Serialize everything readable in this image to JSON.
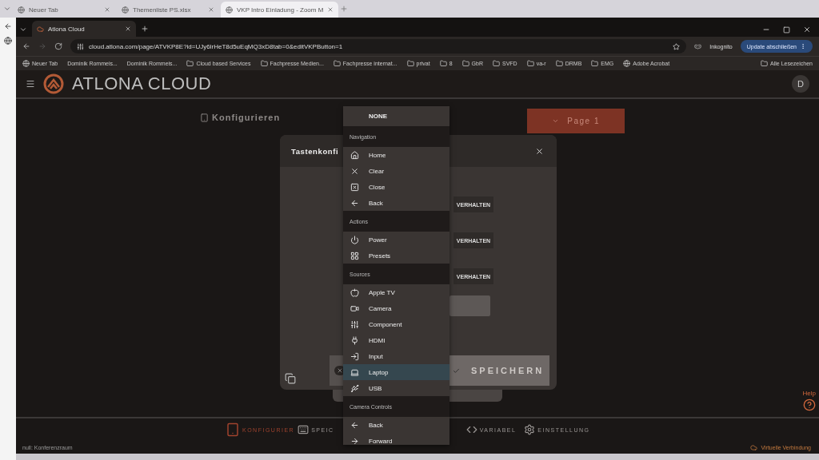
{
  "outer_tabs": [
    {
      "label": "Neuer Tab",
      "selected": false
    },
    {
      "label": "Themenliste PS.xlsx",
      "selected": false
    },
    {
      "label": "VKP Intro Einladung - Zoom M",
      "selected": true
    }
  ],
  "inner_tabs": [
    {
      "label": "Atlona Cloud",
      "selected": true
    }
  ],
  "address_bar": {
    "url": "cloud.atlona.com/page/ATVKP8E?id=UJy6lrHeT8d5uEqMQ3xD8tab=0&editVKPButton=1",
    "incognito": "Inkognito",
    "update_button": "Update abschließen"
  },
  "bookmarks": [
    {
      "label": "Neuer Tab",
      "kind": "site"
    },
    {
      "label": "Dominik Rommeis...",
      "kind": "plain"
    },
    {
      "label": "Dominik Rommeis...",
      "kind": "plain"
    },
    {
      "label": "Cloud based Services",
      "kind": "folder"
    },
    {
      "label": "Fachpresse Medien...",
      "kind": "folder"
    },
    {
      "label": "Fachpresse internat...",
      "kind": "folder"
    },
    {
      "label": "privat",
      "kind": "folder"
    },
    {
      "label": "8",
      "kind": "folder"
    },
    {
      "label": "GbR",
      "kind": "folder"
    },
    {
      "label": "SVFD",
      "kind": "folder"
    },
    {
      "label": "va-r",
      "kind": "folder"
    },
    {
      "label": "DRMB",
      "kind": "folder"
    },
    {
      "label": "EMG",
      "kind": "folder"
    },
    {
      "label": "Adobe Acrobat",
      "kind": "site"
    }
  ],
  "all_bookmarks": "Alle Lesezeichen",
  "app": {
    "logo": "ATLONA CLOUD",
    "avatar": "D",
    "section_title": "Konfigurieren",
    "page_button": "Page 1",
    "help": "Help"
  },
  "modal": {
    "title": "Tastenkonfi",
    "behavior_buttons": [
      "VERHALTEN",
      "VERHALTEN",
      "VERHALTEN"
    ],
    "save_button": "SPEICHERN"
  },
  "menu": {
    "items": [
      {
        "kind": "none",
        "label": "NONE",
        "selected": false
      },
      {
        "kind": "header",
        "label": "Navigation"
      },
      {
        "kind": "item",
        "label": "Home",
        "selected": false
      },
      {
        "kind": "item",
        "label": "Clear",
        "selected": false
      },
      {
        "kind": "item",
        "label": "Close",
        "selected": false
      },
      {
        "kind": "item",
        "label": "Back",
        "selected": false
      },
      {
        "kind": "header",
        "label": "Actions"
      },
      {
        "kind": "item",
        "label": "Power",
        "selected": false
      },
      {
        "kind": "item",
        "label": "Presets",
        "selected": false
      },
      {
        "kind": "header",
        "label": "Sources"
      },
      {
        "kind": "item",
        "label": "Apple TV",
        "selected": false
      },
      {
        "kind": "item",
        "label": "Camera",
        "selected": false
      },
      {
        "kind": "item",
        "label": "Component",
        "selected": false
      },
      {
        "kind": "item",
        "label": "HDMI",
        "selected": false
      },
      {
        "kind": "item",
        "label": "Input",
        "selected": false
      },
      {
        "kind": "item",
        "label": "Laptop",
        "selected": true
      },
      {
        "kind": "item",
        "label": "USB",
        "selected": false
      },
      {
        "kind": "header",
        "label": "Camera Controls"
      },
      {
        "kind": "item",
        "label": "Back",
        "selected": false
      },
      {
        "kind": "item",
        "label": "Forward",
        "selected": false
      }
    ]
  },
  "bottom_nav": [
    {
      "label": "KONFIGURIER",
      "selected": true
    },
    {
      "label": "SPEIC",
      "selected": false
    },
    {
      "label": "VARIABEL",
      "selected": false
    },
    {
      "label": "EINSTELLUNG",
      "selected": false
    }
  ],
  "status_bar": {
    "left": "null: Konferenzraum",
    "right": "Virtuelle Verbindung"
  }
}
